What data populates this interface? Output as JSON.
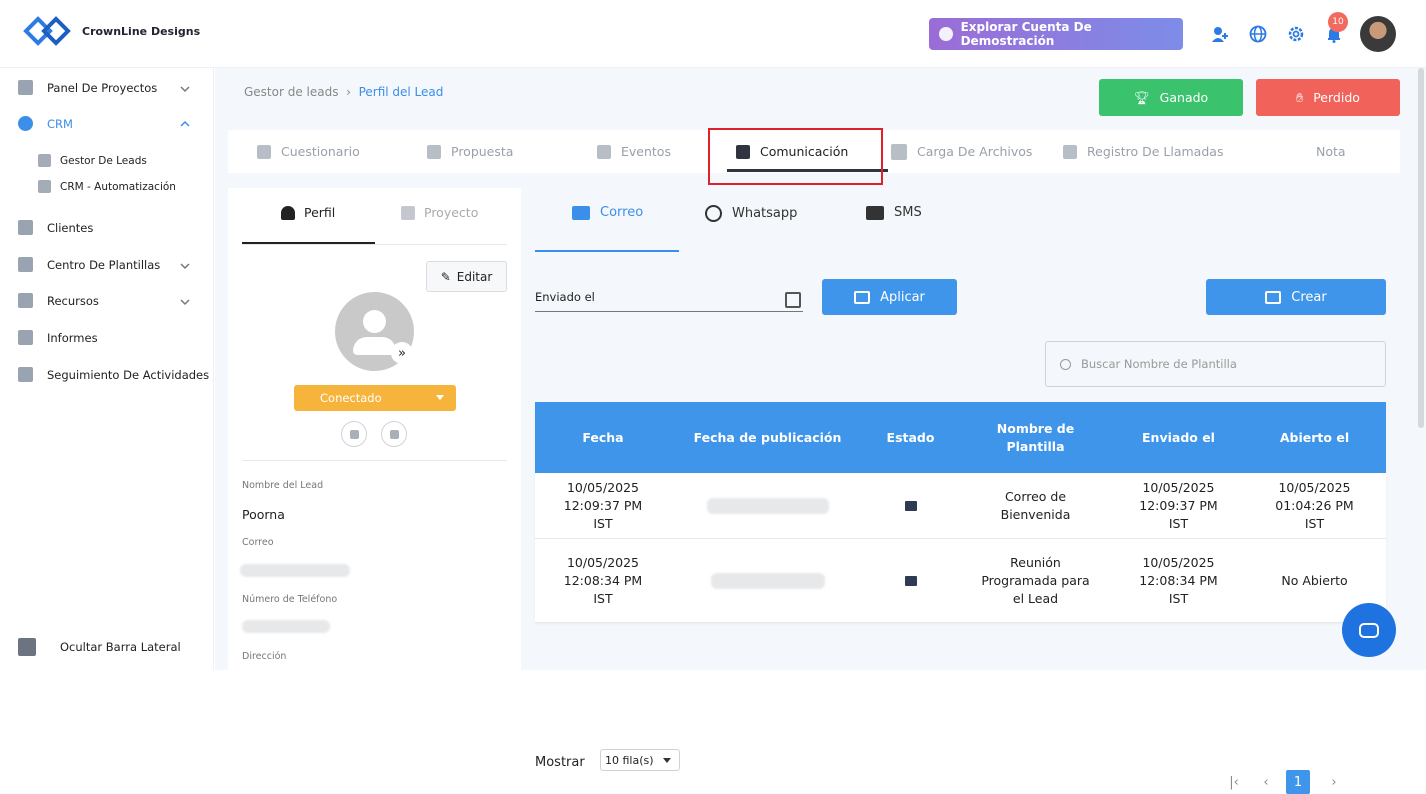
{
  "brand": {
    "name": "CrownLine Designs",
    "accent": "#3b8fe8"
  },
  "topbar": {
    "demo_button": "Explorar Cuenta De Demostración",
    "notification_count": "10"
  },
  "sidebar": {
    "items": [
      {
        "label": "Panel De Proyectos"
      },
      {
        "label": "CRM"
      },
      {
        "label": "Gestor De Leads"
      },
      {
        "label": "CRM - Automatización"
      },
      {
        "label": "Clientes"
      },
      {
        "label": "Centro De Plantillas"
      },
      {
        "label": "Recursos"
      },
      {
        "label": "Informes"
      },
      {
        "label": "Seguimiento De Actividades"
      }
    ],
    "hide_label": "Ocultar Barra Lateral"
  },
  "breadcrumb": {
    "parent": "Gestor de leads",
    "current": "Perfil del Lead"
  },
  "actions": {
    "won": "Ganado",
    "lost": "Perdido"
  },
  "tabs": [
    "Cuestionario",
    "Propuesta",
    "Eventos",
    "Comunicación",
    "Carga De Archivos",
    "Registro De Llamadas",
    "Nota"
  ],
  "profile": {
    "tabs": [
      "Perfil",
      "Proyecto"
    ],
    "edit": "Editar",
    "status": "Conectado",
    "fields": {
      "name_label": "Nombre del Lead",
      "name_value": "Poorna",
      "email_label": "Correo",
      "phone_label": "Número de Teléfono",
      "address_label": "Dirección"
    }
  },
  "comm": {
    "tabs": [
      "Correo",
      "Whatsapp",
      "SMS"
    ],
    "date_label": "Enviado el",
    "apply": "Aplicar",
    "create": "Crear",
    "search_placeholder": "Buscar Nombre de Plantilla",
    "table": {
      "headers": [
        "Fecha",
        "Fecha de publicación",
        "Estado",
        "Nombre de Plantilla",
        "Enviado el",
        "Abierto el"
      ],
      "rows": [
        {
          "fecha": "10/05/2025 12:09:37 PM IST",
          "estado": "opened-envelope-icon",
          "plantilla": "Correo de Bienvenida",
          "enviado": "10/05/2025 12:09:37 PM IST",
          "abierto": "10/05/2025 01:04:26 PM IST"
        },
        {
          "fecha": "10/05/2025 12:08:34 PM IST",
          "estado": "closed-envelope-icon",
          "plantilla": "Reunión Programada para el Lead",
          "enviado": "10/05/2025 12:08:34 PM IST",
          "abierto": "No Abierto"
        }
      ]
    },
    "pager": {
      "show_label": "Mostrar",
      "rows_option": "10 fila(s)",
      "current_page": "1"
    }
  }
}
